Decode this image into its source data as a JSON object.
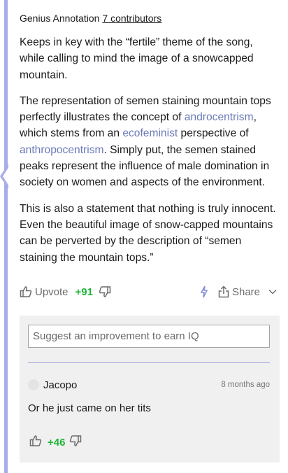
{
  "annotation": {
    "header_label": "Genius Annotation",
    "contributors_link": "7 contributors",
    "paragraphs": {
      "p1": "Keeps in key with the “fertile” theme of the song, while calling to mind the image of a snowcapped mountain.",
      "p2_a": "The representation of semen staining mountain tops perfectly illustrates the concept of ",
      "p2_link1": "androcentrism",
      "p2_b": ", which stems from an ",
      "p2_link2": "ecofeminist",
      "p2_c": " perspective of ",
      "p2_link3": "anthropocentrism",
      "p2_d": ". Simply put, the semen stained peaks represent the influence of male domination in society on women and aspects of the environment.",
      "p3": "This is also a statement that nothing is truly innocent. Even the beautiful image of snow-capped mountains can be perverted by the description of “semen staining the mountain tops.”"
    }
  },
  "votes": {
    "upvote_label": "Upvote",
    "count": "+91",
    "share_label": "Share"
  },
  "suggest": {
    "placeholder": "Suggest an improvement to earn IQ"
  },
  "comment": {
    "author": "Jacopo",
    "time": "8 months ago",
    "body": "Or he just came on her tits",
    "count": "+46"
  },
  "icons": {
    "thumb_up": "thumbs-up-icon",
    "thumb_down": "thumbs-down-icon",
    "bolt": "lightning-icon",
    "share": "share-icon",
    "chevron": "chevron-down-icon"
  },
  "colors": {
    "accent_bar": "#a8acea",
    "link": "#6b7ab8",
    "positive": "#1fb43a",
    "comments_bg": "#f0f0f0"
  }
}
